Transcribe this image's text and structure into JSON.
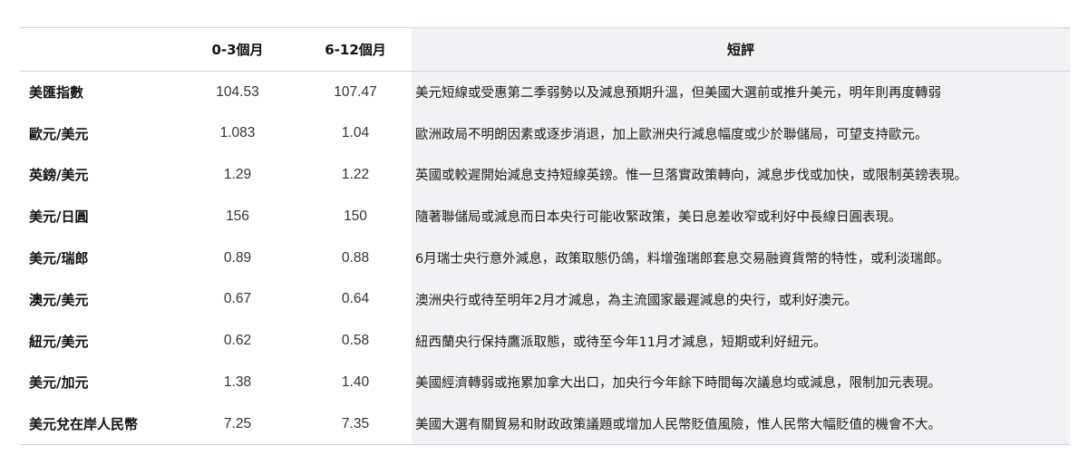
{
  "header": {
    "col_pair": "",
    "col_short": "0-3個月",
    "col_long": "6-12個月",
    "col_comment": "短評"
  },
  "rows": [
    {
      "pair": "美匯指數",
      "short": "104.53",
      "long": "107.47",
      "comment": "美元短線或受惠第二季弱勢以及減息預期升溫，但美國大選前或推升美元，明年則再度轉弱"
    },
    {
      "pair": "歐元/美元",
      "short": "1.083",
      "long": "1.04",
      "comment": "歐洲政局不明朗因素或逐步消退，加上歐洲央行減息幅度或少於聯儲局，可望支持歐元。"
    },
    {
      "pair": "英鎊/美元",
      "short": "1.29",
      "long": "1.22",
      "comment": "英國或較遲開始減息支持短線英鎊。惟一旦落實政策轉向，減息步伐或加快，或限制英鎊表現。"
    },
    {
      "pair": "美元/日圓",
      "short": "156",
      "long": "150",
      "comment": "隨著聯儲局或減息而日本央行可能收緊政策，美日息差收窄或利好中長線日圓表現。"
    },
    {
      "pair": "美元/瑞郎",
      "short": "0.89",
      "long": "0.88",
      "comment": "6月瑞士央行意外減息，政策取態仍鴿，料增強瑞郎套息交易融資貨幣的特性，或利淡瑞郎。"
    },
    {
      "pair": "澳元/美元",
      "short": "0.67",
      "long": "0.64",
      "comment": "澳洲央行或待至明年2月才減息，為主流國家最遲減息的央行，或利好澳元。"
    },
    {
      "pair": "紐元/美元",
      "short": "0.62",
      "long": "0.58",
      "comment": "紐西蘭央行保持鷹派取態，或待至今年11月才減息，短期或利好紐元。"
    },
    {
      "pair": "美元/加元",
      "short": "1.38",
      "long": "1.40",
      "comment": "美國經濟轉弱或拖累加拿大出口，加央行今年餘下時間每次議息均或減息，限制加元表現。"
    },
    {
      "pair": "美元兌在岸人民幣",
      "short": "7.25",
      "long": "7.35",
      "comment": "美國大選有關貿易和財政政策議題或增加人民幣貶值風險，惟人民幣大幅貶值的機會不大。"
    }
  ]
}
